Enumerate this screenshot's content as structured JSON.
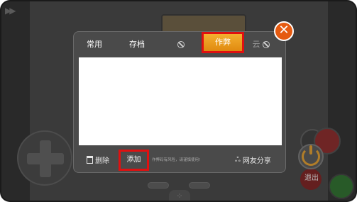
{
  "tabs": [
    {
      "label": "常用"
    },
    {
      "label": "存档"
    },
    {
      "label": "作弊"
    },
    {
      "label": "云"
    }
  ],
  "active_tab": "作弊",
  "footer": {
    "delete_label": "删除",
    "add_label": "添加",
    "warning_text": "作弊码有风险，请谨慎使用!",
    "share_label": "网友分享"
  },
  "exit_label": "退出",
  "colors": {
    "accent_orange": "#f0a020",
    "highlight_red": "#e01010"
  },
  "icons": {
    "close": "close-icon",
    "power": "power-icon",
    "trash": "trash-icon",
    "share": "share-icon",
    "disabled": "disabled-icon"
  }
}
